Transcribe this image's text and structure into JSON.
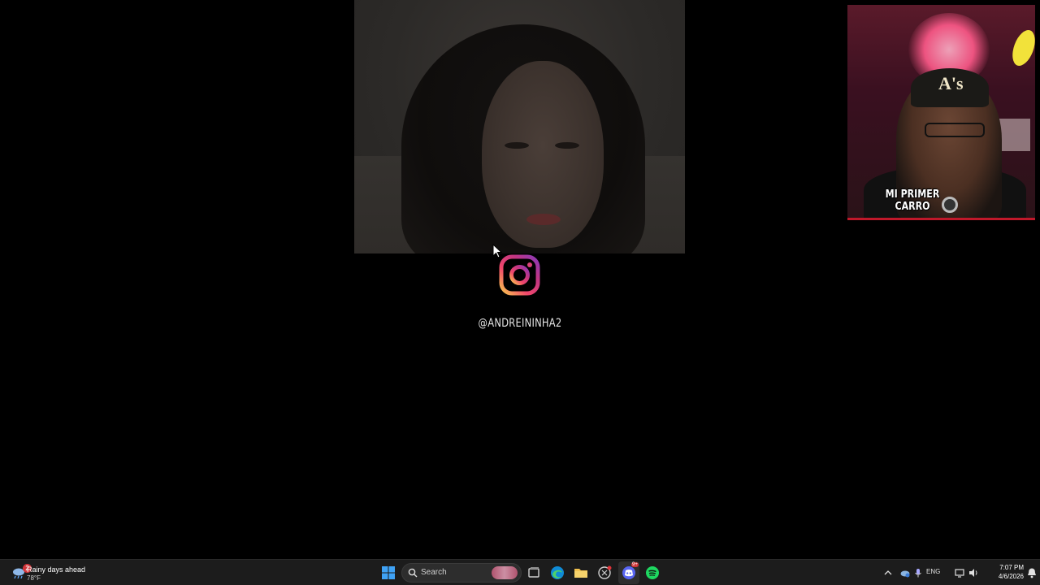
{
  "overlay": {
    "instagram_handle": "@ANDREININHA2",
    "webcam_caption": "MI PRIMER CARRO",
    "cap_logo": "A's"
  },
  "taskbar": {
    "weather": {
      "title": "Rainy days ahead",
      "temperature": "78°F",
      "badge": "2"
    },
    "search_label": "Search",
    "pinned_apps": [
      "windows-start",
      "search",
      "task-view",
      "edge",
      "file-explorer",
      "snipping-tool",
      "discord",
      "spotify"
    ],
    "discord_badge": "9+",
    "tray": {
      "language": "ENG",
      "time": "7:07 PM",
      "date": "4/6/2026"
    }
  },
  "colors": {
    "taskbar_bg": "#1c1c1c",
    "accent_red": "#c0182a",
    "windows_blue": "#3fa2f5",
    "spotify_green": "#1ed760",
    "discord_blurple": "#5865f2"
  }
}
